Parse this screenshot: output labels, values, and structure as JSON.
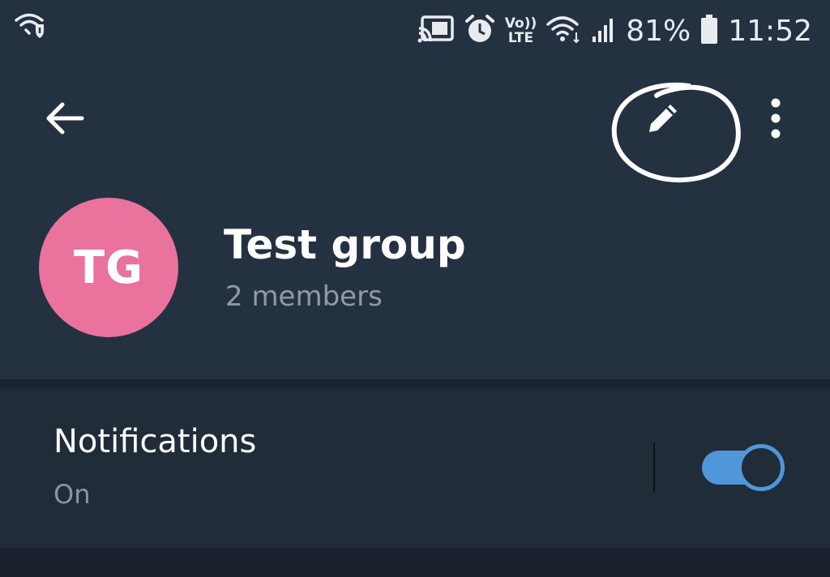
{
  "status_bar": {
    "volte_top": "Vo))",
    "volte_bottom": "LTE",
    "battery": "81%",
    "time": "11:52",
    "icons": [
      "wifi-shield-icon",
      "cast-icon",
      "alarm-icon",
      "volte-icon",
      "wifi-icon",
      "signal-icon",
      "battery-icon"
    ]
  },
  "toolbar": {
    "icons": [
      "back-arrow-icon",
      "pencil-icon",
      "more-vertical-icon"
    ]
  },
  "profile": {
    "initials": "TG",
    "name": "Test group",
    "members": "2 members",
    "avatar_color": "#e9739c"
  },
  "settings": {
    "notifications_label": "Notifications",
    "notifications_value": "On",
    "notifications_enabled": true,
    "accent_color": "#4f97d8"
  },
  "colors": {
    "background": "#243141",
    "card": "#212c39",
    "annotation": "#ffffff"
  }
}
